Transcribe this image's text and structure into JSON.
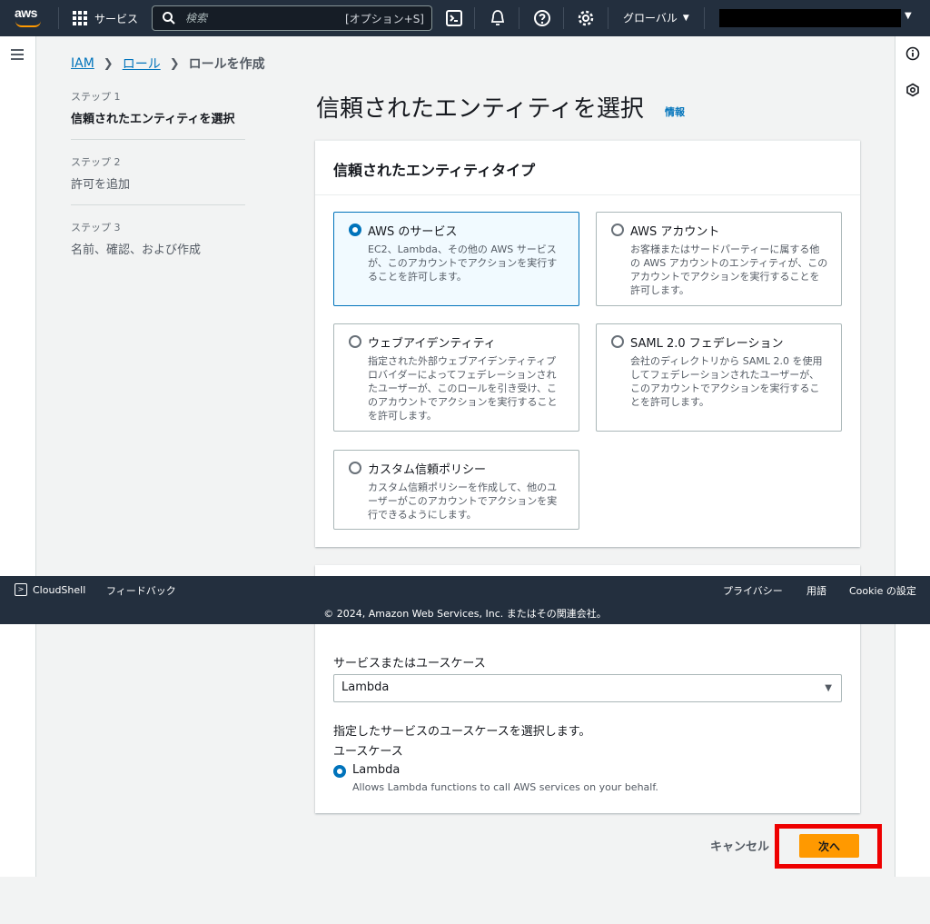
{
  "topnav": {
    "logo": "aws",
    "services_label": "サービス",
    "search_placeholder": "検索",
    "search_shortcut": "[オプション+S]",
    "region_label": "グローバル"
  },
  "breadcrumb": [
    "IAM",
    "ロール",
    "ロールを作成"
  ],
  "steps": [
    {
      "num": "ステップ 1",
      "name": "信頼されたエンティティを選択"
    },
    {
      "num": "ステップ 2",
      "name": "許可を追加"
    },
    {
      "num": "ステップ 3",
      "name": "名前、確認、および作成"
    }
  ],
  "page_title": "信頼されたエンティティを選択",
  "info_link": "情報",
  "entity_card": {
    "title": "信頼されたエンティティタイプ",
    "options": [
      {
        "title": "AWS のサービス",
        "desc": "EC2、Lambda、その他の AWS サービスが、このアカウントでアクションを実行することを許可します。"
      },
      {
        "title": "AWS アカウント",
        "desc": "お客様またはサードパーティーに属する他の AWS アカウントのエンティティが、このアカウントでアクションを実行することを許可します。"
      },
      {
        "title": "ウェブアイデンティティ",
        "desc": "指定された外部ウェブアイデンティティプロバイダーによってフェデレーションされたユーザーが、このロールを引き受け、このアカウントでアクションを実行することを許可します。"
      },
      {
        "title": "SAML 2.0 フェデレーション",
        "desc": "会社のディレクトリから SAML 2.0 を使用してフェデレーションされたユーザーが、このアカウントでアクションを実行することを許可します。"
      },
      {
        "title": "カスタム信頼ポリシー",
        "desc": "カスタム信頼ポリシーを作成して、他のユーザーがこのアカウントでアクションを実行できるようにします。"
      }
    ]
  },
  "usecase_card": {
    "service_label": "サービスまたはユースケース",
    "service_value": "Lambda",
    "choose_text": "指定したサービスのユースケースを選択します。",
    "usecase_label": "ユースケース",
    "usecase_title": "Lambda",
    "usecase_desc": "Allows Lambda functions to call AWS services on your behalf."
  },
  "footer": {
    "cloudshell": "CloudShell",
    "feedback": "フィードバック",
    "privacy": "プライバシー",
    "terms": "用語",
    "cookie": "Cookie の設定",
    "copyright": "© 2024, Amazon Web Services, Inc. またはその関連会社。"
  },
  "actions": {
    "cancel": "キャンセル",
    "next": "次へ"
  },
  "colors": {
    "nav_bg": "#232f3e",
    "accent": "#0073bb",
    "primary_button": "#ff9900",
    "highlight": "#ee0000"
  }
}
